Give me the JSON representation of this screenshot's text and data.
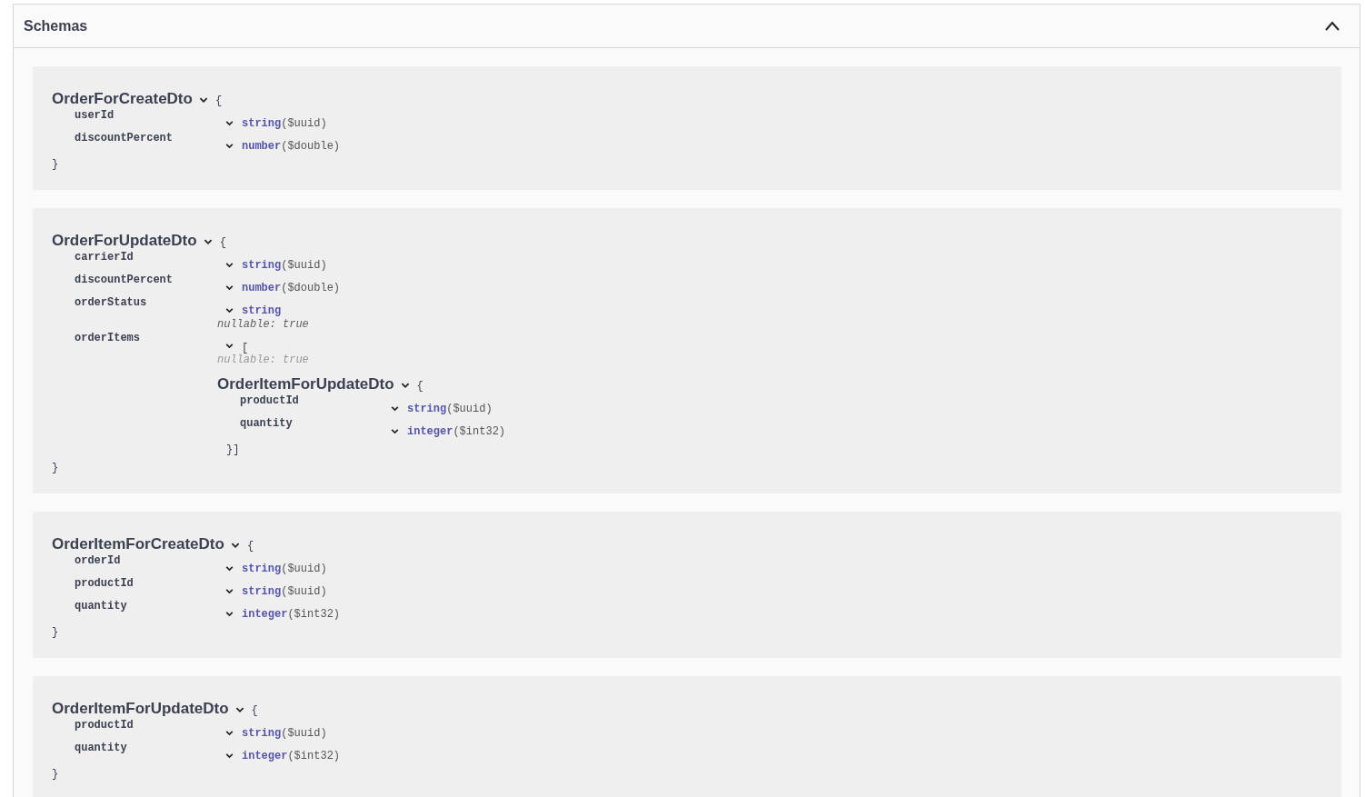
{
  "section": {
    "title": "Schemas",
    "expanded": true
  },
  "schemas": [
    {
      "name": "OrderForCreateDto",
      "open": "{",
      "close": "}",
      "properties": [
        {
          "name": "userId",
          "kind": "primitive",
          "type": "string",
          "format": "($uuid)"
        },
        {
          "name": "discountPercent",
          "kind": "primitive",
          "type": "number",
          "format": "($double)"
        }
      ]
    },
    {
      "name": "OrderForUpdateDto",
      "open": "{",
      "close": "}",
      "properties": [
        {
          "name": "carrierId",
          "kind": "primitive",
          "type": "string",
          "format": "($uuid)"
        },
        {
          "name": "discountPercent",
          "kind": "primitive",
          "type": "number",
          "format": "($double)"
        },
        {
          "name": "orderStatus",
          "kind": "primitive",
          "type": "string",
          "nullable": "nullable: true"
        },
        {
          "name": "orderItems",
          "kind": "array",
          "open": "[",
          "nullable": "nullable: true",
          "items": {
            "name": "OrderItemForUpdateDto",
            "open": "{",
            "close": "}]",
            "properties": [
              {
                "name": "productId",
                "kind": "primitive",
                "type": "string",
                "format": "($uuid)"
              },
              {
                "name": "quantity",
                "kind": "primitive",
                "type": "integer",
                "format": "($int32)"
              }
            ]
          }
        }
      ]
    },
    {
      "name": "OrderItemForCreateDto",
      "open": "{",
      "close": "}",
      "properties": [
        {
          "name": "orderId",
          "kind": "primitive",
          "type": "string",
          "format": "($uuid)"
        },
        {
          "name": "productId",
          "kind": "primitive",
          "type": "string",
          "format": "($uuid)"
        },
        {
          "name": "quantity",
          "kind": "primitive",
          "type": "integer",
          "format": "($int32)"
        }
      ]
    },
    {
      "name": "OrderItemForUpdateDto",
      "open": "{",
      "close": "}",
      "properties": [
        {
          "name": "productId",
          "kind": "primitive",
          "type": "string",
          "format": "($uuid)"
        },
        {
          "name": "quantity",
          "kind": "primitive",
          "type": "integer",
          "format": "($int32)"
        }
      ]
    }
  ]
}
